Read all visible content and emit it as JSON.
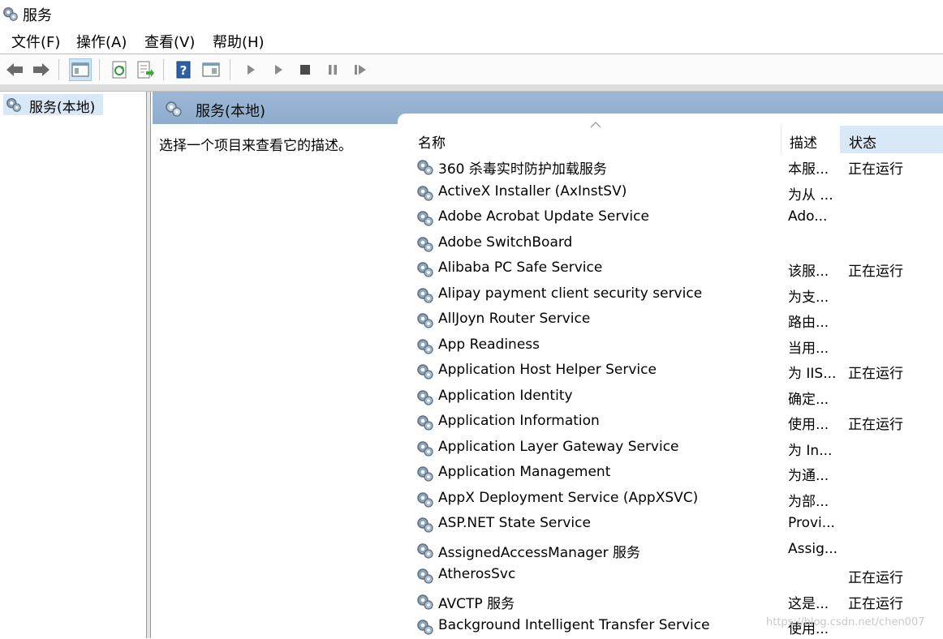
{
  "window": {
    "title": "服务"
  },
  "menu": [
    "文件(F)",
    "操作(A)",
    "查看(V)",
    "帮助(H)"
  ],
  "toolbar": {
    "buttons": [
      "back-icon",
      "forward-icon",
      "console-tree-icon",
      "refresh-icon",
      "export-list-icon",
      "help-icon",
      "properties-icon",
      "start-icon",
      "start-alt-icon",
      "stop-icon",
      "pause-icon",
      "restart-icon"
    ]
  },
  "tree": {
    "root_label": "服务(本地)"
  },
  "pane": {
    "header_label": "服务(本地)",
    "description_prompt": "选择一个项目来查看它的描述。"
  },
  "columns": {
    "name": "名称",
    "description": "描述",
    "status": "状态"
  },
  "services": [
    {
      "name": "360 杀毒实时防护加载服务",
      "desc": "本服...",
      "status": "正在运行"
    },
    {
      "name": "ActiveX Installer (AxInstSV)",
      "desc": "为从 ...",
      "status": ""
    },
    {
      "name": "Adobe Acrobat Update Service",
      "desc": "Ado...",
      "status": ""
    },
    {
      "name": "Adobe SwitchBoard",
      "desc": "",
      "status": ""
    },
    {
      "name": "Alibaba PC Safe Service",
      "desc": "该服...",
      "status": "正在运行"
    },
    {
      "name": "Alipay payment client security service",
      "desc": "为支...",
      "status": ""
    },
    {
      "name": "AllJoyn Router Service",
      "desc": "路由...",
      "status": ""
    },
    {
      "name": "App Readiness",
      "desc": "当用...",
      "status": ""
    },
    {
      "name": "Application Host Helper Service",
      "desc": "为 IIS...",
      "status": "正在运行"
    },
    {
      "name": "Application Identity",
      "desc": "确定...",
      "status": ""
    },
    {
      "name": "Application Information",
      "desc": "使用...",
      "status": "正在运行"
    },
    {
      "name": "Application Layer Gateway Service",
      "desc": "为 In...",
      "status": ""
    },
    {
      "name": "Application Management",
      "desc": "为通...",
      "status": ""
    },
    {
      "name": "AppX Deployment Service (AppXSVC)",
      "desc": "为部...",
      "status": ""
    },
    {
      "name": "ASP.NET State Service",
      "desc": "Provi...",
      "status": ""
    },
    {
      "name": "AssignedAccessManager 服务",
      "desc": "Assig...",
      "status": ""
    },
    {
      "name": "AtherosSvc",
      "desc": "",
      "status": "正在运行"
    },
    {
      "name": "AVCTP 服务",
      "desc": "这是...",
      "status": "正在运行"
    },
    {
      "name": "Background Intelligent Transfer Service",
      "desc": "使用...",
      "status": ""
    }
  ],
  "watermark": "https://blog.csdn.net/chen007"
}
